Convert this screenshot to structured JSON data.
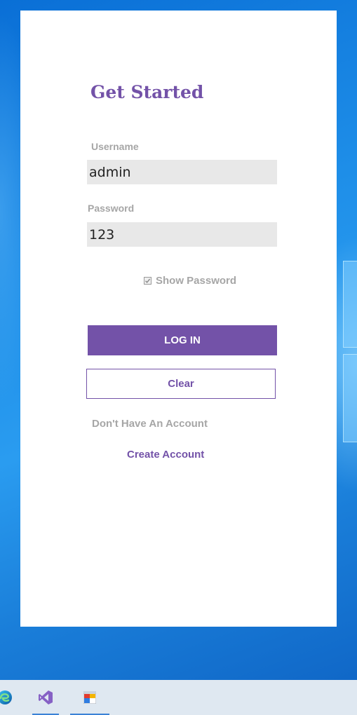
{
  "login": {
    "title": "Get Started",
    "username_label": "Username",
    "username_value": "admin",
    "password_label": "Password",
    "password_value": "123",
    "show_password_label": "Show Password",
    "show_password_checked": true,
    "login_button": "LOG IN",
    "clear_button": "Clear",
    "no_account_text": "Don't Have An Account",
    "create_account_link": "Create Account"
  },
  "taskbar": {
    "icons": [
      "edge-browser-icon",
      "visual-studio-icon",
      "windows-forms-app-icon"
    ],
    "active_underline_color": "#3b82d6"
  },
  "colors": {
    "accent": "#7352a8",
    "label_gray": "#a6a6a6",
    "field_bg": "#e8e8e8",
    "window_bg": "#ffffff"
  }
}
